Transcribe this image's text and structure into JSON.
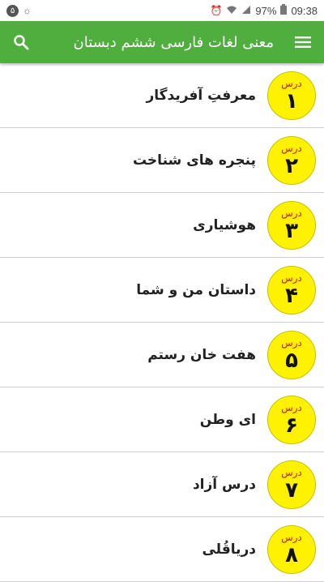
{
  "status_bar": {
    "notification_count": "۵",
    "battery": "97%",
    "time": "09:38"
  },
  "app_bar": {
    "title": "معنی لغات فارسی ششم دبستان",
    "search_icon": "search-icon",
    "menu_icon": "menu-icon"
  },
  "lessons": [
    {
      "label": "درس",
      "number": "۱",
      "title": "معرفتِ آفریدگار"
    },
    {
      "label": "درس",
      "number": "۲",
      "title": "پنجره های شناخت"
    },
    {
      "label": "درس",
      "number": "۳",
      "title": "هوشیاری"
    },
    {
      "label": "درس",
      "number": "۴",
      "title": "داستان من و شما"
    },
    {
      "label": "درس",
      "number": "۵",
      "title": "هفت خان رستم"
    },
    {
      "label": "درس",
      "number": "۶",
      "title": "ای وطن"
    },
    {
      "label": "درس",
      "number": "۷",
      "title": "درس آزاد"
    },
    {
      "label": "درس",
      "number": "۸",
      "title": "دریاقُلی"
    }
  ],
  "colors": {
    "app_bar": "#4fae3e",
    "badge": "#fff200",
    "badge_label": "#c41e1e"
  }
}
